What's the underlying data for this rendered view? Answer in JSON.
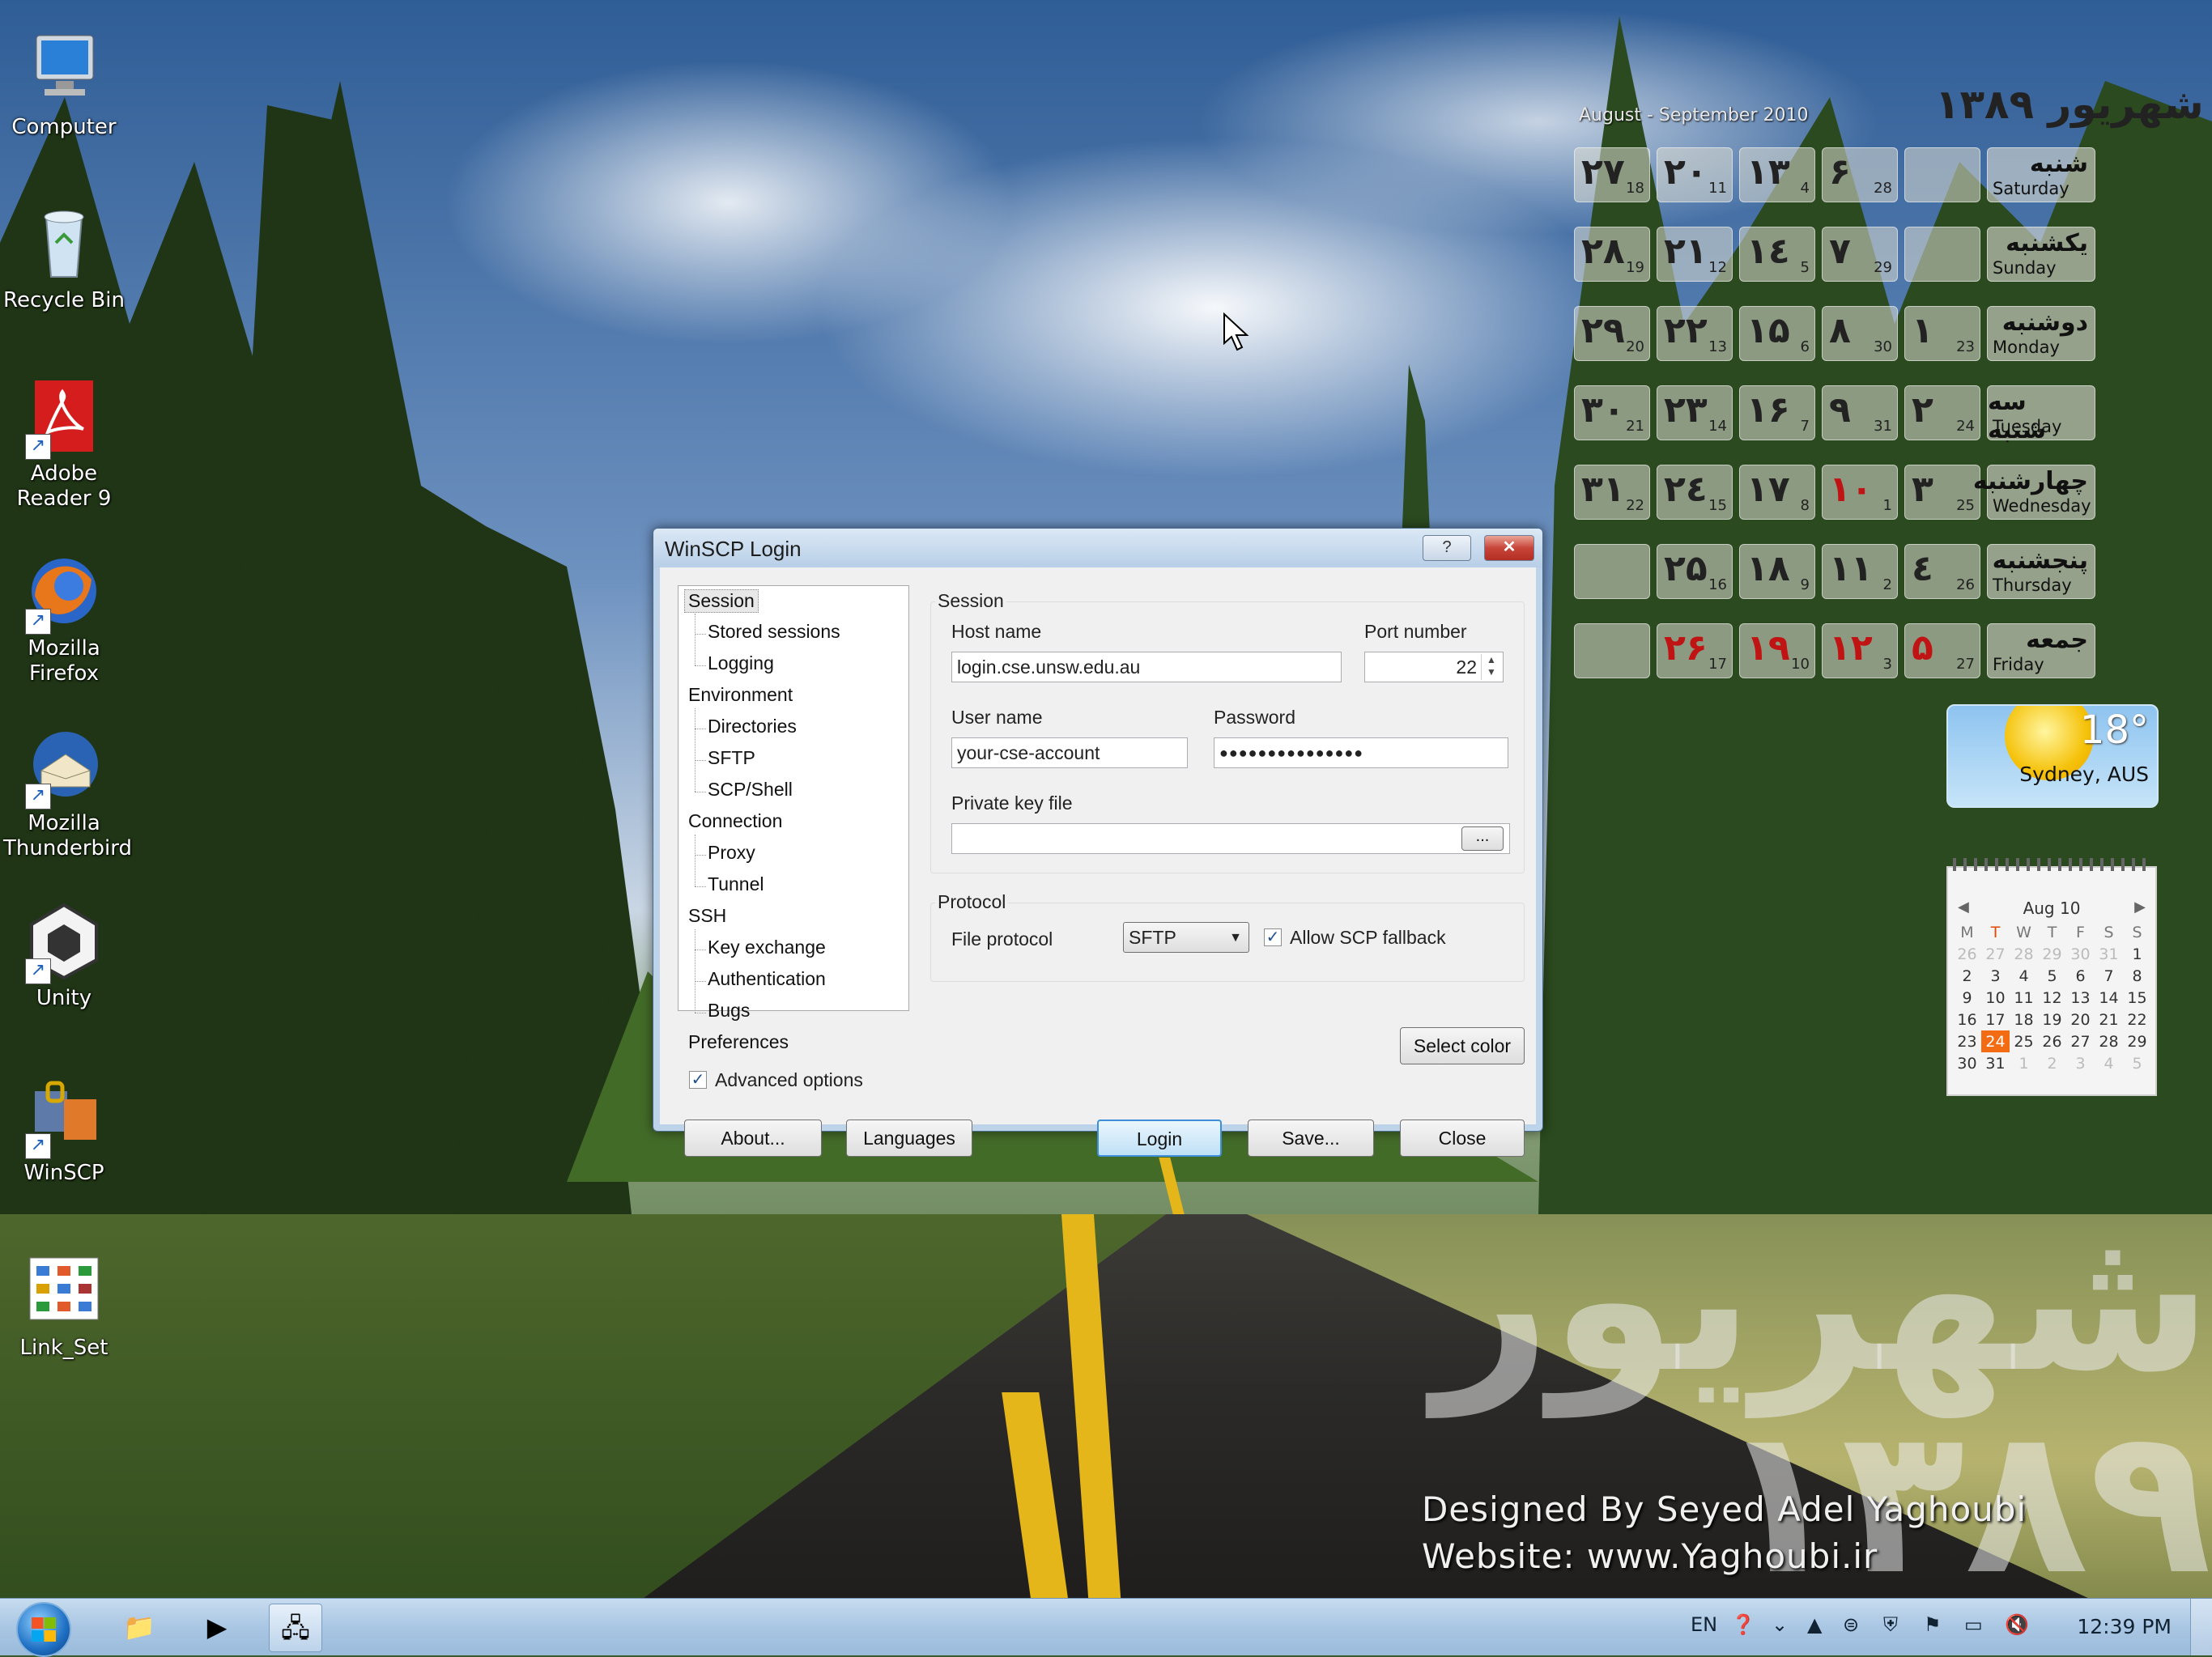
{
  "desktop": {
    "icons": [
      {
        "label": "Computer",
        "icon": "computer-icon"
      },
      {
        "label": "Recycle Bin",
        "icon": "recycle-bin-icon"
      },
      {
        "label": "Adobe Reader 9",
        "icon": "adobe-reader-icon"
      },
      {
        "label": "Mozilla Firefox",
        "icon": "firefox-icon"
      },
      {
        "label": "Mozilla Thunderbird",
        "icon": "thunderbird-icon"
      },
      {
        "label": "Unity",
        "icon": "unity-icon"
      },
      {
        "label": "WinSCP",
        "icon": "winscp-icon"
      },
      {
        "label": "Link_Set",
        "icon": "link-set-icon"
      }
    ],
    "wallpaper": {
      "big_text": "شهریور ۱۳۸۹",
      "credit_line1": "Designed By Seyed Adel Yaghoubi",
      "credit_line2": "Website: www.Yaghoubi.ir"
    }
  },
  "calendar_gadget": {
    "header_en": "August - September 2010",
    "header_fa": "شهریور ۱۳۸۹",
    "weekdays": [
      {
        "fa": "شنبه",
        "en": "Saturday"
      },
      {
        "fa": "یکشنبه",
        "en": "Sunday"
      },
      {
        "fa": "دوشنبه",
        "en": "Monday"
      },
      {
        "fa": "سه شنبه",
        "en": "Tuesday"
      },
      {
        "fa": "چهارشنبه",
        "en": "Wednesday"
      },
      {
        "fa": "پنجشنبه",
        "en": "Thursday"
      },
      {
        "fa": "جمعه",
        "en": "Friday"
      }
    ],
    "rows": [
      [
        {
          "fa": "۲۷",
          "g": "18"
        },
        {
          "fa": "۲۰",
          "g": "11"
        },
        {
          "fa": "۱۳",
          "g": "4"
        },
        {
          "fa": "۶",
          "g": "28"
        },
        {
          "fa": "",
          "g": ""
        }
      ],
      [
        {
          "fa": "۲۸",
          "g": "19"
        },
        {
          "fa": "۲۱",
          "g": "12"
        },
        {
          "fa": "۱٤",
          "g": "5"
        },
        {
          "fa": "۷",
          "g": "29"
        },
        {
          "fa": "",
          "g": ""
        }
      ],
      [
        {
          "fa": "۲۹",
          "g": "20"
        },
        {
          "fa": "۲۲",
          "g": "13"
        },
        {
          "fa": "۱۵",
          "g": "6"
        },
        {
          "fa": "۸",
          "g": "30"
        },
        {
          "fa": "۱",
          "g": "23"
        }
      ],
      [
        {
          "fa": "۳۰",
          "g": "21"
        },
        {
          "fa": "۲۳",
          "g": "14"
        },
        {
          "fa": "۱۶",
          "g": "7"
        },
        {
          "fa": "۹",
          "g": "31"
        },
        {
          "fa": "۲",
          "g": "24"
        }
      ],
      [
        {
          "fa": "۳۱",
          "g": "22"
        },
        {
          "fa": "۲٤",
          "g": "15"
        },
        {
          "fa": "۱۷",
          "g": "8"
        },
        {
          "fa": "۱۰",
          "g": "1",
          "red": true
        },
        {
          "fa": "۳",
          "g": "25"
        }
      ],
      [
        {
          "fa": "",
          "g": ""
        },
        {
          "fa": "۲۵",
          "g": "16"
        },
        {
          "fa": "۱۸",
          "g": "9"
        },
        {
          "fa": "۱۱",
          "g": "2"
        },
        {
          "fa": "٤",
          "g": "26"
        }
      ],
      [
        {
          "fa": "",
          "g": ""
        },
        {
          "fa": "۲۶",
          "g": "17",
          "red": true
        },
        {
          "fa": "۱۹",
          "g": "10",
          "red": true
        },
        {
          "fa": "۱۲",
          "g": "3",
          "red": true
        },
        {
          "fa": "۵",
          "g": "27",
          "red": true
        }
      ]
    ]
  },
  "weather": {
    "temp": "18°",
    "city": "Sydney, AUS"
  },
  "mini_calendar": {
    "title": "Aug 10",
    "headers": [
      "M",
      "T",
      "W",
      "T",
      "F",
      "S",
      "S"
    ],
    "weeks": [
      [
        "26",
        "27",
        "28",
        "29",
        "30",
        "31",
        "1"
      ],
      [
        "2",
        "3",
        "4",
        "5",
        "6",
        "7",
        "8"
      ],
      [
        "9",
        "10",
        "11",
        "12",
        "13",
        "14",
        "15"
      ],
      [
        "16",
        "17",
        "18",
        "19",
        "20",
        "21",
        "22"
      ],
      [
        "23",
        "24",
        "25",
        "26",
        "27",
        "28",
        "29"
      ],
      [
        "30",
        "31",
        "1",
        "2",
        "3",
        "4",
        "5"
      ]
    ],
    "today": "24"
  },
  "dialog": {
    "title": "WinSCP Login",
    "help_label": "?",
    "close_label": "✕",
    "tree": [
      {
        "label": "Session",
        "level": 0,
        "selected": true
      },
      {
        "label": "Stored sessions",
        "level": 1
      },
      {
        "label": "Logging",
        "level": 1
      },
      {
        "label": "Environment",
        "level": 0
      },
      {
        "label": "Directories",
        "level": 1
      },
      {
        "label": "SFTP",
        "level": 1
      },
      {
        "label": "SCP/Shell",
        "level": 1
      },
      {
        "label": "Connection",
        "level": 0
      },
      {
        "label": "Proxy",
        "level": 1
      },
      {
        "label": "Tunnel",
        "level": 1
      },
      {
        "label": "SSH",
        "level": 0
      },
      {
        "label": "Key exchange",
        "level": 1
      },
      {
        "label": "Authentication",
        "level": 1
      },
      {
        "label": "Bugs",
        "level": 1
      },
      {
        "label": "Preferences",
        "level": 0
      }
    ],
    "session_group": "Session",
    "host_name_label": "Host name",
    "host_name_value": "login.cse.unsw.edu.au",
    "port_label": "Port number",
    "port_value": "22",
    "user_name_label": "User name",
    "user_name_value": "your-cse-account",
    "password_label": "Password",
    "password_value": "●●●●●●●●●●●●●●●",
    "private_key_label": "Private key file",
    "private_key_value": "",
    "browse_label": "...",
    "protocol_group": "Protocol",
    "file_protocol_label": "File protocol",
    "file_protocol_value": "SFTP",
    "allow_scp_label": "Allow SCP fallback",
    "select_color_label": "Select color",
    "advanced_label": "Advanced options",
    "about_label": "About...",
    "languages_label": "Languages",
    "login_label": "Login",
    "save_label": "Save...",
    "close_button_label": "Close"
  },
  "taskbar": {
    "language": "EN",
    "clock": "12:39 PM"
  }
}
